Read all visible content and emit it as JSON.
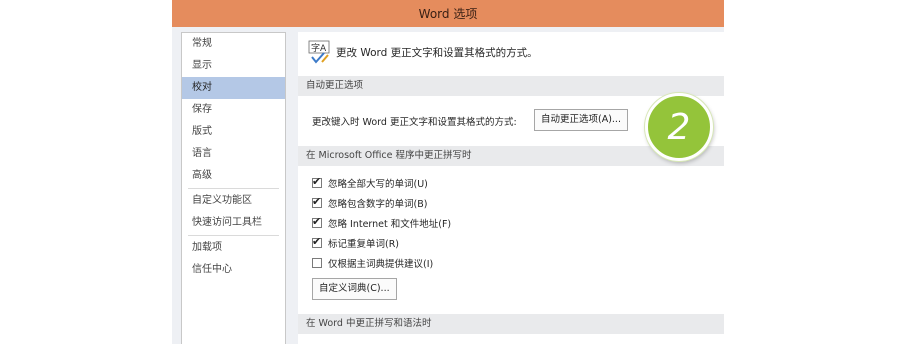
{
  "window": {
    "title": "Word 选项"
  },
  "nav": {
    "items": [
      {
        "label": "常规"
      },
      {
        "label": "显示"
      },
      {
        "label": "校对",
        "selected": true
      },
      {
        "label": "保存"
      },
      {
        "label": "版式"
      },
      {
        "label": "语言"
      },
      {
        "label": "高级"
      },
      {
        "label": "自定义功能区"
      },
      {
        "label": "快速访问工具栏"
      },
      {
        "label": "加载项"
      },
      {
        "label": "信任中心"
      }
    ]
  },
  "panel": {
    "header_text": "更改 Word 更正文字和设置其格式的方式。",
    "header_icon": "abc-check-icon",
    "autocorrect_section": {
      "title": "自动更正选项",
      "description": "更改键入时 Word 更正文字和设置其格式的方式:",
      "button_label": "自动更正选项(A)..."
    },
    "office_section": {
      "title": "在 Microsoft Office 程序中更正拼写时",
      "options": [
        {
          "label": "忽略全部大写的单词(U)",
          "checked": true
        },
        {
          "label": "忽略包含数字的单词(B)",
          "checked": true
        },
        {
          "label": "忽略 Internet 和文件地址(F)",
          "checked": true
        },
        {
          "label": "标记重复单词(R)",
          "checked": true
        },
        {
          "label": "仅根据主词典提供建议(I)",
          "checked": false
        }
      ],
      "dict_button_label": "自定义词典(C)..."
    },
    "word_section": {
      "title": "在 Word 中更正拼写和语法时"
    }
  },
  "badge": {
    "label": "2",
    "color": "#94c43a"
  },
  "colors": {
    "titlebar": "#e58c5d",
    "selected_nav": "#b4c8e6"
  }
}
